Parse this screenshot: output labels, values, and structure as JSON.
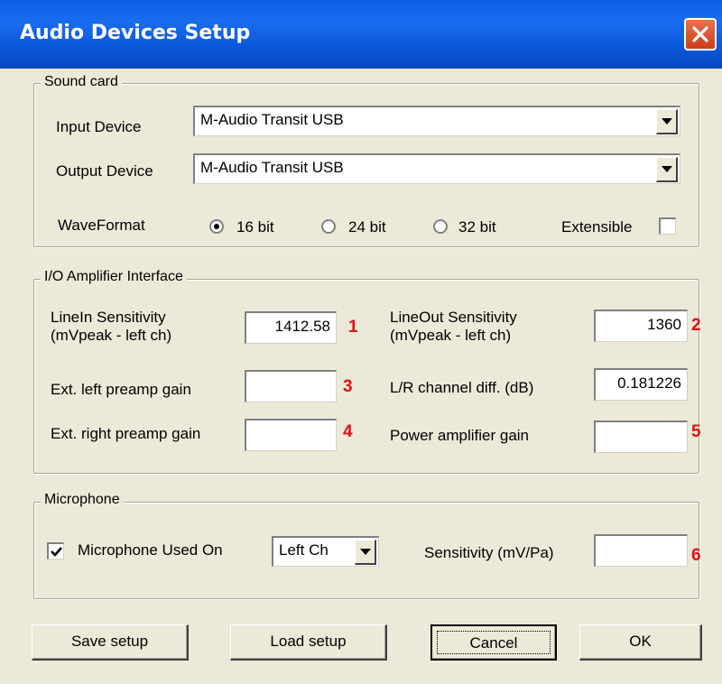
{
  "window": {
    "title": "Audio Devices Setup"
  },
  "sound_card": {
    "legend": "Sound card",
    "input_device_label": "Input Device",
    "input_device_value": "M-Audio Transit USB",
    "output_device_label": "Output Device",
    "output_device_value": "M-Audio Transit USB",
    "waveformat_label": "WaveFormat",
    "radio_16": "16 bit",
    "radio_24": "24 bit",
    "radio_32": "32 bit",
    "selected_format": "16 bit",
    "extensible_label": "Extensible",
    "extensible_checked": false
  },
  "io_amp": {
    "legend": "I/O Amplifier Interface",
    "linein_label_1": "LineIn Sensitivity",
    "linein_label_2": "(mVpeak - left ch)",
    "linein_value": "1412.58",
    "lineout_label_1": "LineOut Sensitivity",
    "lineout_label_2": "(mVpeak - left ch)",
    "lineout_value": "1360",
    "left_preamp_label": "Ext. left preamp gain",
    "left_preamp_value": "",
    "lr_diff_label": "L/R channel diff. (dB)",
    "lr_diff_value": "0.181226",
    "right_preamp_label": "Ext. right preamp gain",
    "right_preamp_value": "",
    "power_amp_label": "Power amplifier gain",
    "power_amp_value": ""
  },
  "microphone": {
    "legend": "Microphone",
    "used_on_label": "Microphone Used On",
    "used_on_checked": true,
    "channel_value": "Left Ch",
    "sensitivity_label": "Sensitivity (mV/Pa)",
    "sensitivity_value": ""
  },
  "annotations": [
    "1",
    "2",
    "3",
    "4",
    "5",
    "6"
  ],
  "buttons": {
    "save": "Save setup",
    "load": "Load setup",
    "cancel": "Cancel",
    "ok": "OK"
  },
  "colors": {
    "titlebar": "#0a5fe6",
    "face": "#ece9d8",
    "annotation": "#e01010"
  }
}
